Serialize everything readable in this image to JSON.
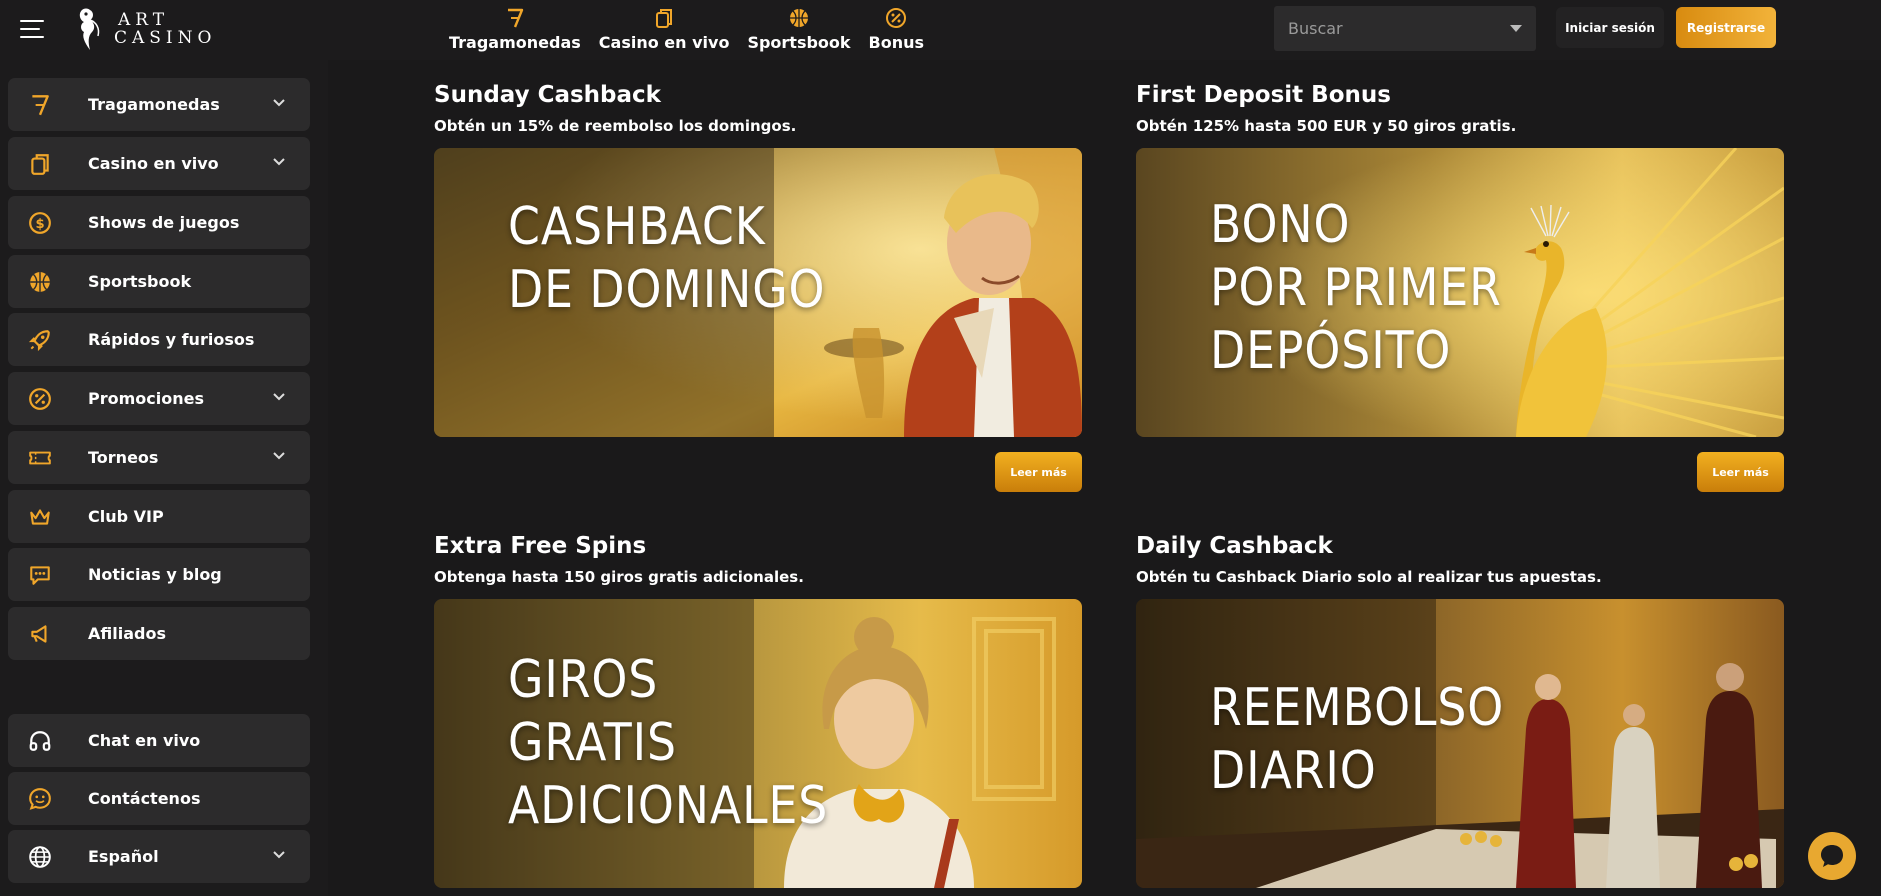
{
  "header": {
    "logo_line1": "ART",
    "logo_line2": "CASINO",
    "nav": [
      {
        "label": "Tragamonedas",
        "icon": "seven-icon"
      },
      {
        "label": "Casino en vivo",
        "icon": "cards-icon"
      },
      {
        "label": "Sportsbook",
        "icon": "basketball-icon"
      },
      {
        "label": "Bonus",
        "icon": "percent-icon"
      }
    ],
    "search_placeholder": "Buscar",
    "login_label": "Iniciar sesión",
    "register_label": "Registrarse"
  },
  "sidebar": {
    "items": [
      {
        "label": "Tragamonedas",
        "icon": "seven-icon",
        "expandable": true
      },
      {
        "label": "Casino en vivo",
        "icon": "cards-icon",
        "expandable": true
      },
      {
        "label": "Shows de juegos",
        "icon": "coin-icon",
        "expandable": false
      },
      {
        "label": "Sportsbook",
        "icon": "basketball-icon",
        "expandable": false
      },
      {
        "label": "Rápidos y furiosos",
        "icon": "rocket-icon",
        "expandable": false
      },
      {
        "label": "Promociones",
        "icon": "percent-icon",
        "expandable": true
      },
      {
        "label": "Torneos",
        "icon": "ticket-icon",
        "expandable": true
      },
      {
        "label": "Club VIP",
        "icon": "crown-icon",
        "expandable": false
      },
      {
        "label": "Noticias y blog",
        "icon": "chat-dots-icon",
        "expandable": false
      },
      {
        "label": "Afiliados",
        "icon": "megaphone-icon",
        "expandable": false
      }
    ],
    "bottom_items": [
      {
        "label": "Chat en vivo",
        "icon": "headphones-icon",
        "expandable": false
      },
      {
        "label": "Contáctenos",
        "icon": "smile-icon",
        "expandable": false
      },
      {
        "label": "Español",
        "icon": "globe-icon",
        "expandable": true
      }
    ]
  },
  "promos": [
    {
      "title": "Sunday Cashback",
      "subtitle": "Obtén un 15% de reembolso los domingos.",
      "banner_text": "CASHBACK\nDE DOMINGO",
      "read_more": "Leer más"
    },
    {
      "title": "First Deposit Bonus",
      "subtitle": "Obtén 125% hasta 500 EUR y 50 giros gratis.",
      "banner_text": "BONO\nPOR PRIMER\nDEPÓSITO",
      "read_more": "Leer más"
    },
    {
      "title": "Extra Free Spins",
      "subtitle": "Obtenga hasta 150 giros gratis adicionales.",
      "banner_text": "GIROS\nGRATIS\nADICIONALES"
    },
    {
      "title": "Daily Cashback",
      "subtitle": "Obtén tu Cashback Diario solo al realizar tus apuestas.",
      "banner_text": "REEMBOLSO\nDIARIO"
    }
  ],
  "colors": {
    "accent": "#e8a22a",
    "background": "#1c1b1c",
    "sidebar_item": "#2c2b2c"
  }
}
